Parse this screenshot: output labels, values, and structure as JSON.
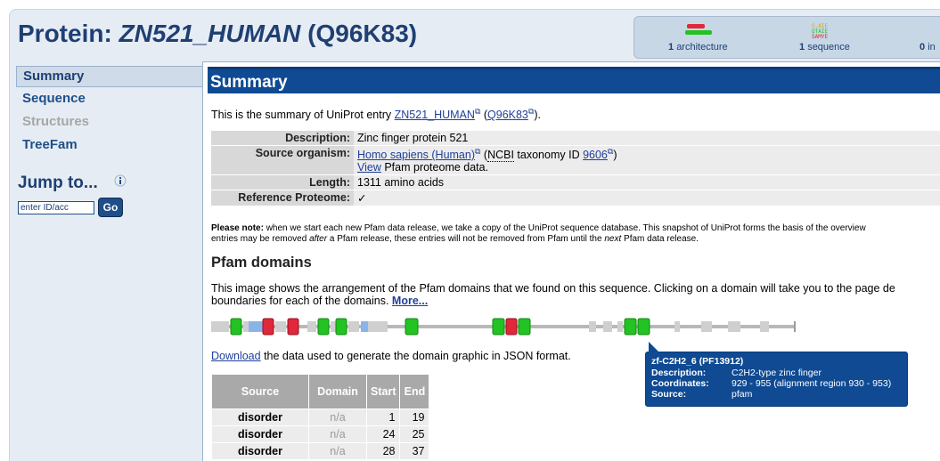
{
  "page": {
    "title_prefix": "Protein: ",
    "title_entry": "ZN521_HUMAN",
    "title_acc": "(Q96K83)"
  },
  "summary_box": {
    "items": [
      {
        "count": "1",
        "label": "architecture"
      },
      {
        "count": "1",
        "label": "sequence"
      },
      {
        "count": "0",
        "label": "in"
      }
    ]
  },
  "sidebar": {
    "items": [
      {
        "label": "Summary",
        "state": "active"
      },
      {
        "label": "Sequence",
        "state": "normal"
      },
      {
        "label": "Structures",
        "state": "disabled"
      },
      {
        "label": "TreeFam",
        "state": "normal"
      }
    ],
    "jump_title": "Jump to...",
    "jump_placeholder": "enter ID/acc",
    "go_label": "Go"
  },
  "main": {
    "header": "Summary",
    "intro_pre": "This is the summary of UniProt entry ",
    "intro_entry": "ZN521_HUMAN",
    "intro_mid": " (",
    "intro_acc": "Q96K83",
    "intro_post": ").",
    "description": {
      "rows": [
        {
          "label": "Description:",
          "value": "Zinc finger protein 521"
        },
        {
          "label": "Source organism:",
          "organism": "Homo sapiens (Human)",
          "ncbi_pre": " (",
          "ncbi": "NCBI",
          "ncbi_post": " taxonomy ID ",
          "taxid": "9606",
          "close": ")",
          "view": "View",
          "view_post": " Pfam proteome data."
        },
        {
          "label": "Length:",
          "value": "1311 amino acids"
        },
        {
          "label": "Reference Proteome:",
          "value": "✓"
        }
      ]
    },
    "note_bold": "Please note:",
    "note_line1": " when we start each new Pfam data release, we take a copy of the UniProt sequence database. This snapshot of UniProt forms the basis of the overview",
    "note_line2_pre": "entries may be removed ",
    "note_after": "after",
    "note_line2_mid": " a Pfam release, these entries will not be removed from Pfam until the ",
    "note_next": "next",
    "note_line2_post": " Pfam data release.",
    "pfam_heading": "Pfam domains",
    "pfam_para_line1": "This image shows the arrangement of the Pfam domains that we found on this sequence. Clicking on a domain will take you to the page de",
    "pfam_para_line2": "boundaries for each of the domains. ",
    "more_link": "More...",
    "download_link": "Download",
    "download_post": " the data used to generate the domain graphic in JSON format.",
    "source_table": {
      "headers": [
        "Source",
        "Domain",
        "Start",
        "End"
      ],
      "rows": [
        {
          "source": "disorder",
          "domain": "n/a",
          "start": "1",
          "end": "19"
        },
        {
          "source": "disorder",
          "domain": "n/a",
          "start": "24",
          "end": "25"
        },
        {
          "source": "disorder",
          "domain": "n/a",
          "start": "28",
          "end": "37"
        }
      ]
    }
  },
  "tooltip": {
    "title": "zf-C2H2_6 (PF13912)",
    "rows": [
      {
        "key": "Description:",
        "value": "C2H2-type zinc finger"
      },
      {
        "key": "Coordinates:",
        "value": "929 - 955 (alignment region 930 - 953)"
      },
      {
        "key": "Source:",
        "value": "pfam"
      }
    ]
  },
  "colors": {
    "header_blue": "#0f4a93",
    "title_blue": "#1f3f73",
    "domain_green": "#22c322",
    "domain_red": "#e0283a",
    "disorder_grey": "#cfcfcf",
    "low_complexity_blue": "#8ab4e8"
  }
}
